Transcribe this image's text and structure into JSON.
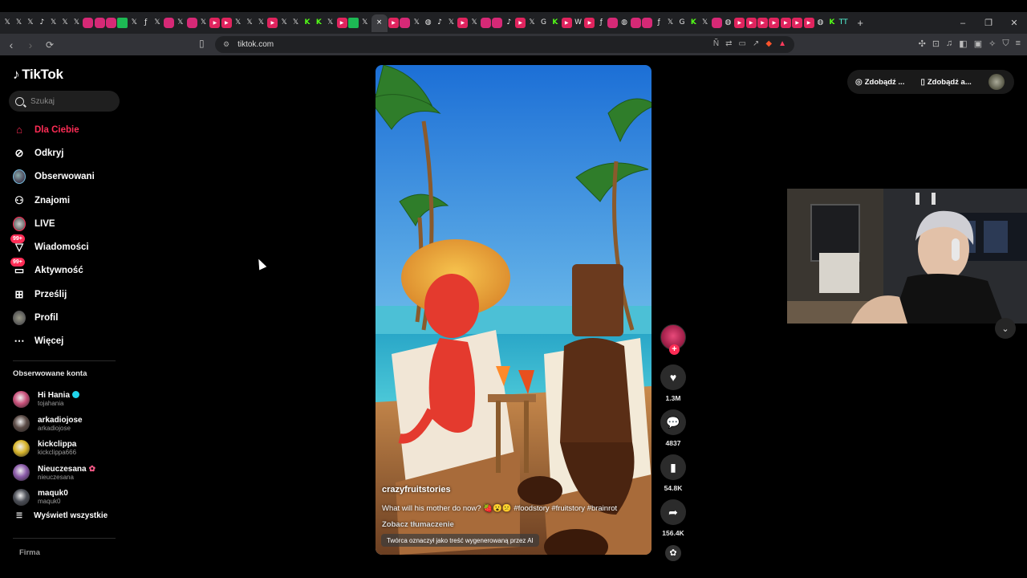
{
  "browser": {
    "url": "tiktok.com",
    "tab_icons": [
      "x",
      "x",
      "x",
      "tiktok",
      "x",
      "x",
      "x",
      "insta",
      "insta",
      "insta",
      "green",
      "x",
      "fb",
      "x",
      "insta",
      "x",
      "insta",
      "x",
      "red",
      "red",
      "x",
      "x",
      "x",
      "red",
      "x",
      "x",
      "kick",
      "kick",
      "x",
      "red",
      "green",
      "x",
      "active",
      "red",
      "insta",
      "x",
      "globe",
      "tiktok",
      "x",
      "red",
      "x",
      "insta",
      "insta",
      "tiktok",
      "red",
      "x",
      "google",
      "kick",
      "red",
      "wiki",
      "red",
      "f",
      "insta",
      "globe",
      "insta",
      "insta",
      "fb",
      "x",
      "google",
      "kick",
      "x",
      "insta",
      "globe",
      "red",
      "red",
      "red",
      "red",
      "red",
      "red",
      "red",
      "globe",
      "kick",
      "tt"
    ],
    "active_tab_close": "×",
    "new_tab": "+",
    "window_buttons": [
      "–",
      "❐",
      "✕"
    ]
  },
  "tiktok": {
    "logo": "TikTok",
    "search_placeholder": "Szukaj",
    "nav": [
      {
        "label": "Dla Ciebie",
        "icon": "home-icon",
        "active": true
      },
      {
        "label": "Odkryj",
        "icon": "compass-icon"
      },
      {
        "label": "Obserwowani",
        "icon": "avatar"
      },
      {
        "label": "Znajomi",
        "icon": "friends-icon"
      },
      {
        "label": "LIVE",
        "icon": "live-avatar"
      },
      {
        "label": "Wiadomości",
        "icon": "messages-icon",
        "badge": "99+"
      },
      {
        "label": "Aktywność",
        "icon": "activity-icon",
        "badge": "99+"
      },
      {
        "label": "Prześlij",
        "icon": "upload-icon"
      },
      {
        "label": "Profil",
        "icon": "profile-avatar"
      },
      {
        "label": "Więcej",
        "icon": "more-icon"
      }
    ],
    "followed_heading": "Obserwowane konta",
    "accounts": [
      {
        "name": "Hi Hania",
        "username": "tojahania",
        "verified": true,
        "color": "#c9507a"
      },
      {
        "name": "arkadiojose",
        "username": "arkadiojose",
        "color": "#5a4a45"
      },
      {
        "name": "kickclippa",
        "username": "kickclippa666",
        "color": "#d8b52a"
      },
      {
        "name": "Nieuczesana",
        "username": "nieuczesana",
        "flower": "✿",
        "color": "#8a5aa8"
      },
      {
        "name": "maquk0",
        "username": "maquk0",
        "color": "#4a4d55"
      }
    ],
    "show_all": "Wyświetl wszystkie",
    "footer_first": "Firma",
    "get_buttons": [
      "Zdobądź ...",
      "Zdobądź a..."
    ]
  },
  "video": {
    "author": "crazyfruitstories",
    "caption": "What will his mother do now? 🍓😮😕 #foodstory #fruitstory #brainrot",
    "translate": "Zobacz tłumaczenie",
    "ai_label": "Twórca oznaczył jako treść wygenerowaną przez AI",
    "likes": "1.3M",
    "comments": "4837",
    "saves": "54.8K",
    "shares": "156.4K"
  }
}
